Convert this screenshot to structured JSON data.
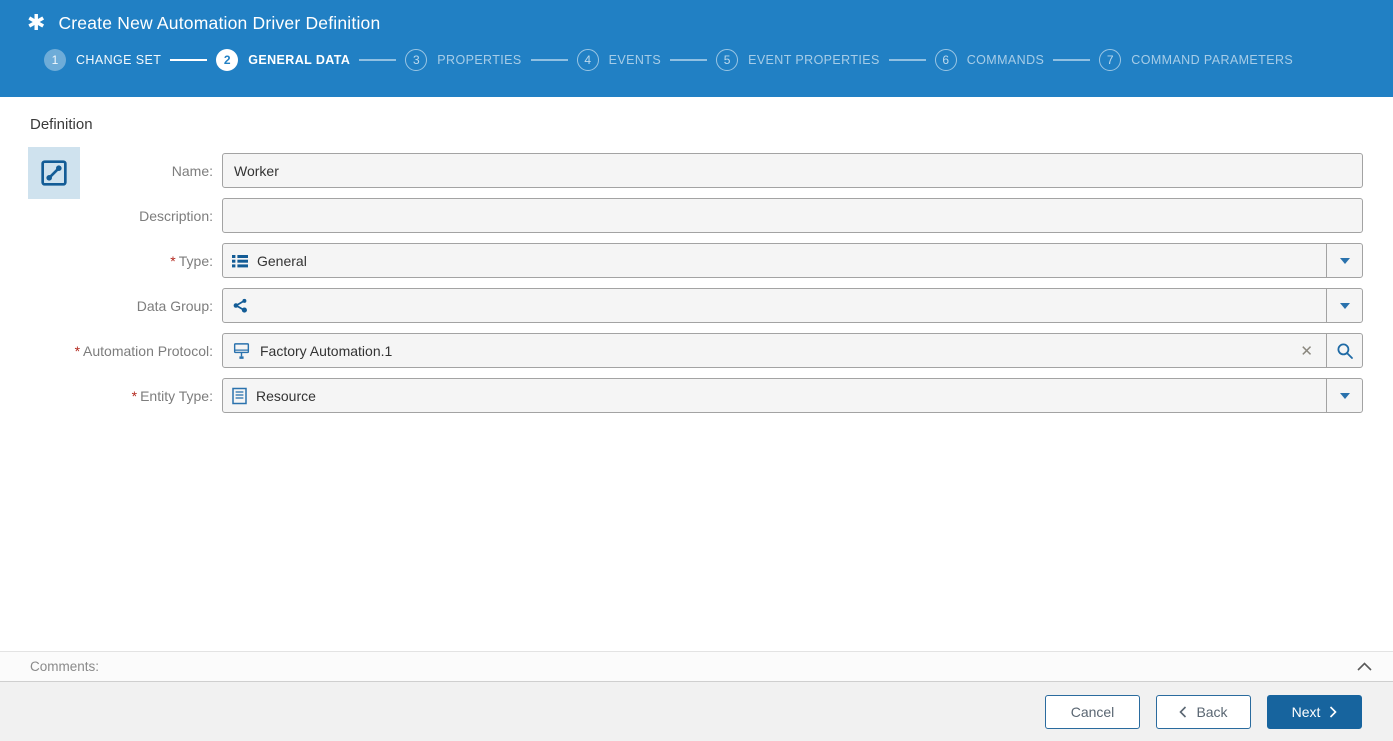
{
  "header": {
    "title": "Create New Automation Driver Definition",
    "title_icon": "✱",
    "steps": [
      {
        "num": "1",
        "label": "CHANGE SET",
        "state": "completed"
      },
      {
        "num": "2",
        "label": "GENERAL DATA",
        "state": "active"
      },
      {
        "num": "3",
        "label": "PROPERTIES",
        "state": "pending"
      },
      {
        "num": "4",
        "label": "EVENTS",
        "state": "pending"
      },
      {
        "num": "5",
        "label": "EVENT PROPERTIES",
        "state": "pending"
      },
      {
        "num": "6",
        "label": "COMMANDS",
        "state": "pending"
      },
      {
        "num": "7",
        "label": "COMMAND PARAMETERS",
        "state": "pending"
      }
    ]
  },
  "form": {
    "section_title": "Definition",
    "required_marker": "*",
    "fields": {
      "name": {
        "label": "Name:",
        "value": "Worker"
      },
      "description": {
        "label": "Description:",
        "value": ""
      },
      "type": {
        "label": "Type:",
        "value": "General",
        "required": true,
        "icon": "list-icon"
      },
      "data_group": {
        "label": "Data Group:",
        "value": "",
        "icon": "share-icon"
      },
      "automation_protocol": {
        "label": "Automation Protocol:",
        "value": "Factory Automation.1",
        "required": true,
        "icon": "network-terminal-icon",
        "clear_icon": "✕"
      },
      "entity_type": {
        "label": "Entity Type:",
        "value": "Resource",
        "required": true,
        "icon": "document-list-icon"
      }
    }
  },
  "comments": {
    "label": "Comments:"
  },
  "footer": {
    "cancel_label": "Cancel",
    "back_label": "Back",
    "next_label": "Next"
  },
  "colors": {
    "header_blue": "#2180c4",
    "primary_button_blue": "#17649e",
    "accent_blue": "#1f6aa5",
    "icon_blue": "#135c96",
    "required_red": "#b3281e",
    "field_bg": "#f5f5f5",
    "field_border": "#a3a3a3",
    "footer_bg": "#f1f1f1"
  }
}
